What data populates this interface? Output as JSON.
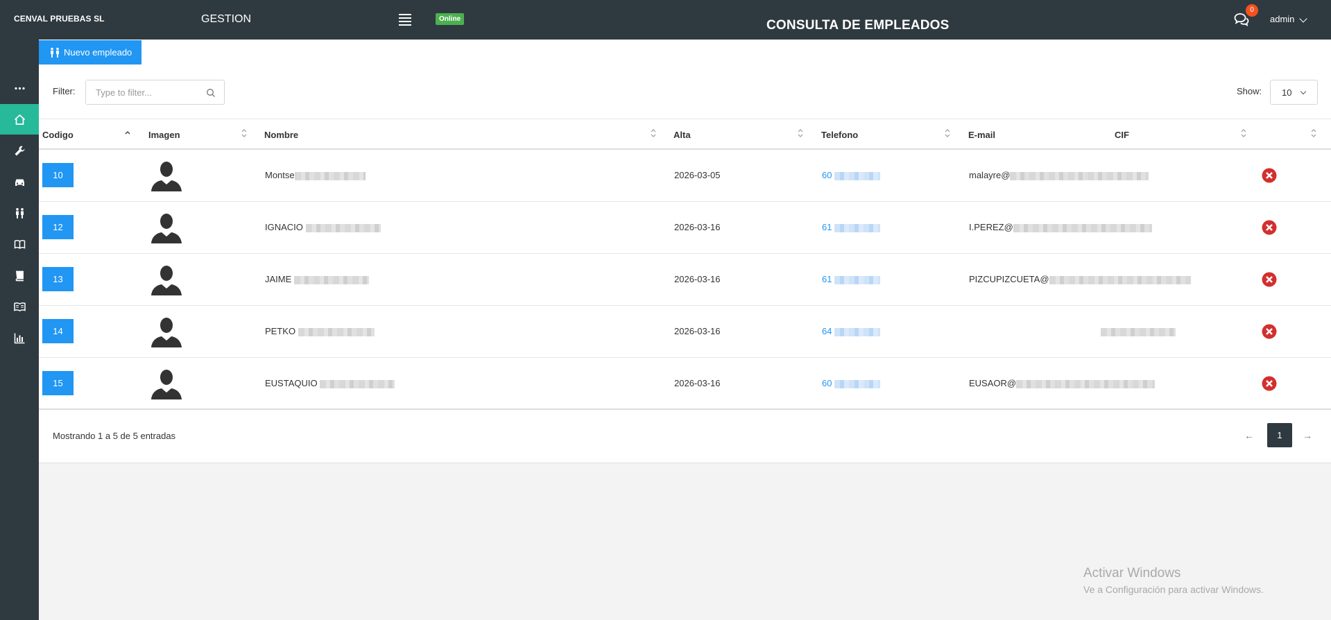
{
  "header": {
    "brand": "CENVAL PRUEBAS SL",
    "section": "GESTION",
    "status": "Online",
    "page_title": "CONSULTA DE EMPLEADOS",
    "notifications": "0",
    "user": "admin"
  },
  "sidebar": {
    "items": [
      {
        "icon": "more-dots-icon"
      },
      {
        "icon": "home-icon",
        "active": true
      },
      {
        "icon": "wrench-icon"
      },
      {
        "icon": "car-icon"
      },
      {
        "icon": "people-icon"
      },
      {
        "icon": "open-book-icon"
      },
      {
        "icon": "book-icon"
      },
      {
        "icon": "reading-book-icon"
      },
      {
        "icon": "bar-chart-icon"
      }
    ]
  },
  "toolbar": {
    "new_button": "Nuevo empleado",
    "filter_label": "Filter:",
    "filter_placeholder": "Type to filter...",
    "show_label": "Show:",
    "show_value": "10"
  },
  "table": {
    "headers": {
      "codigo": "Codigo",
      "imagen": "Imagen",
      "nombre": "Nombre",
      "alta": "Alta",
      "telefono": "Telefono",
      "email": "E-mail",
      "cif": "CIF"
    },
    "rows": [
      {
        "codigo": "10",
        "nombre": "Montse",
        "alta": "2026-03-05",
        "telefono": "60",
        "email": "malayre@"
      },
      {
        "codigo": "12",
        "nombre": "IGNACIO",
        "alta": "2026-03-16",
        "telefono": "61",
        "email": "I.PEREZ@"
      },
      {
        "codigo": "13",
        "nombre": "JAIME",
        "alta": "2026-03-16",
        "telefono": "61",
        "email": "PIZCUPIZCUETA@"
      },
      {
        "codigo": "14",
        "nombre": "PETKO",
        "alta": "2026-03-16",
        "telefono": "64",
        "email": ""
      },
      {
        "codigo": "15",
        "nombre": "EUSTAQUIO",
        "alta": "2026-03-16",
        "telefono": "60",
        "email": "EUSAOR@"
      }
    ]
  },
  "footer": {
    "info": "Mostrando 1 a 5 de 5 entradas",
    "prev": "←",
    "page": "1",
    "next": "→"
  },
  "watermark": {
    "line1": "Activar Windows",
    "line2": "Ve a Configuración para activar Windows."
  },
  "colors": {
    "dark": "#2f3a40",
    "accent": "#26b99a",
    "primary": "#2196f3",
    "danger": "#d32f2f",
    "online": "#4caf50"
  }
}
